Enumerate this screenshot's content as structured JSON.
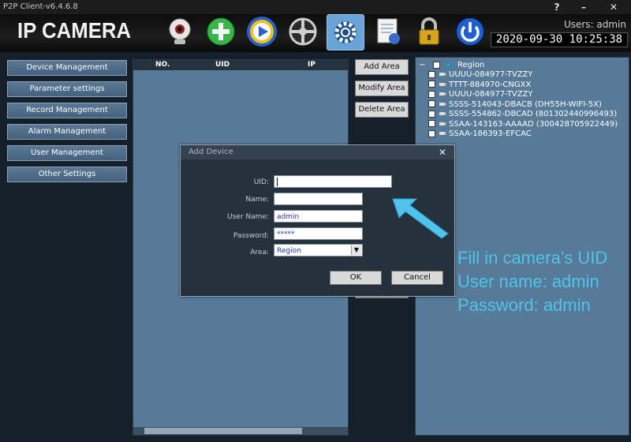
{
  "window": {
    "title": "P2P Client-v6.4.6.8",
    "help": "?",
    "minimize": "–",
    "close": "✕"
  },
  "header": {
    "brand": "IP CAMERA",
    "users_label": "Users: admin",
    "clock": "2020-09-30 10:25:38",
    "toolbar_icons": [
      "camera-icon",
      "add-icon",
      "play-icon",
      "ptz-icon",
      "settings-icon",
      "log-icon",
      "lock-icon",
      "power-icon"
    ]
  },
  "menu": {
    "items": [
      "Device Management",
      "Parameter settings",
      "Record Management",
      "Alarm Management",
      "User Management",
      "Other Settings"
    ]
  },
  "device_list": {
    "columns": [
      "NO.",
      "UID",
      "IP"
    ]
  },
  "area_buttons": {
    "add": "Add Area",
    "modify": "Modify Area",
    "delete": "Delete Area"
  },
  "region_tree": {
    "expander": "−",
    "root": "Region",
    "items": [
      "UUUU-084977-TVZZY",
      "TTTT-884970-CNGXX",
      "UUUU-084977-TVZZY",
      "SSSS-514043-DBACB  (DH55H-WIFI-5X)",
      "SSSS-554862-DBCAD  (801302440996493)",
      "SSAA-143163-AAAAD  (300428705922449)",
      "SSAA-186393-EFCAC"
    ]
  },
  "dialog": {
    "title": "Add Device",
    "close": "✕",
    "uid_label": "UID:",
    "uid_value": "",
    "name_label": "Name:",
    "name_value": "",
    "username_label": "User Name:",
    "username_value": "admin",
    "password_label": "Password:",
    "password_value": "*****",
    "area_label": "Area:",
    "area_value": "Region",
    "ok": "OK",
    "cancel": "Cancel"
  },
  "instructions": {
    "line1": "Fill in camera’s UID",
    "line2": "User name: admin",
    "line3": "Password: admin"
  },
  "colors": {
    "accent": "#4fc3ec",
    "panel": "#587a99",
    "menu": "#4e6b88"
  }
}
